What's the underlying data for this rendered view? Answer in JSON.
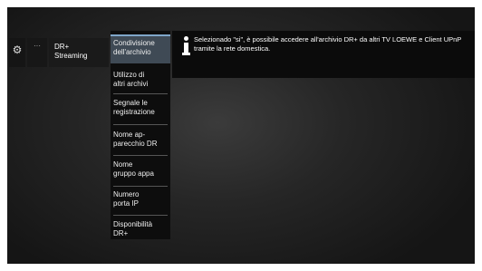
{
  "nav": {
    "gear_icon": "gear-icon",
    "more_icon": "ellipsis-icon",
    "more_label": "···",
    "dr_streaming": "DR+\nStreaming"
  },
  "menu": {
    "items": [
      {
        "label": "Condivisione\ndell'archivio",
        "selected": true
      },
      {
        "label": "Utilizzo di\naltri archivi",
        "selected": false
      },
      {
        "label": "Segnale le\nregistrazione",
        "selected": false
      },
      {
        "label": "Nome ap-\nparecchio DR",
        "selected": false
      },
      {
        "label": "Nome\ngruppo appa",
        "selected": false
      },
      {
        "label": "Numero\nporta IP",
        "selected": false
      },
      {
        "label": "Disponibilità\nDR+",
        "selected": false
      }
    ],
    "selected_accent": "#7fa6c9"
  },
  "info": {
    "icon": "info-icon",
    "text": "Selezionado \"si\", è possibile accedere all'archivio DR+ da altri TV LOEWE e Client UPnP tramite la rete domestica."
  }
}
